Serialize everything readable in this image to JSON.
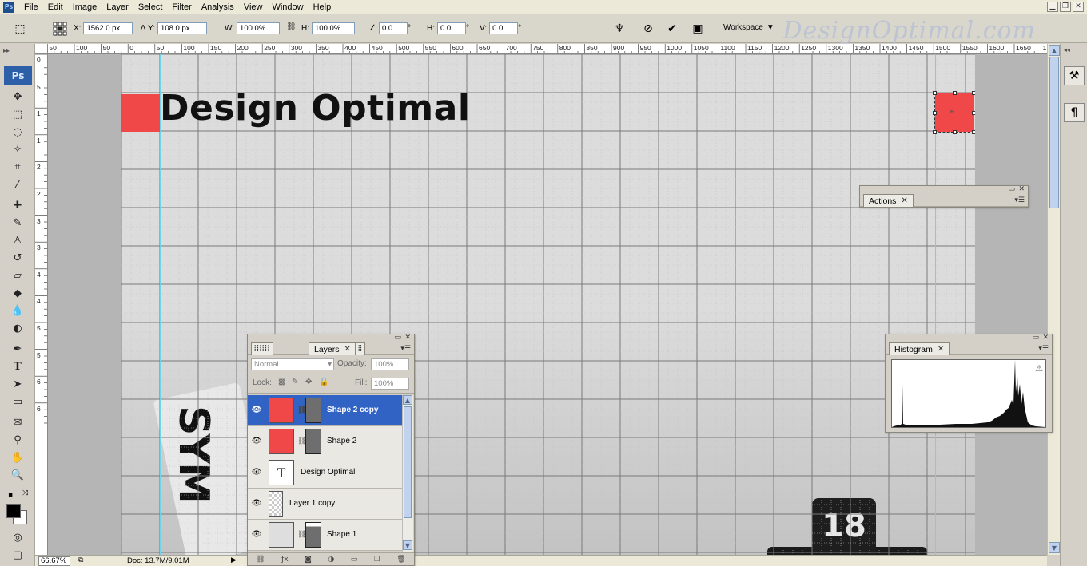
{
  "menu": [
    "File",
    "Edit",
    "Image",
    "Layer",
    "Select",
    "Filter",
    "Analysis",
    "View",
    "Window",
    "Help"
  ],
  "app_icon": "Ps",
  "window_controls": [
    "minimize",
    "restore",
    "close"
  ],
  "options": {
    "x_label": "X:",
    "x_value": "1562.0 px",
    "y_label": "Y:",
    "y_value": "108.0 px",
    "w_label": "W:",
    "w_value": "100.0%",
    "h_label": "H:",
    "h_value": "100.0%",
    "angle_value": "0.0",
    "angle_unit": "°",
    "hskew_label": "H:",
    "hskew_value": "0.0",
    "hskew_unit": "°",
    "vskew_label": "V:",
    "vskew_value": "0.0",
    "vskew_unit": "°",
    "workspace_label": "Workspace"
  },
  "watermark": "DesignOptimal.com",
  "tools_badge": "Ps",
  "ruler_top_labels": [
    "50",
    "100",
    "50",
    "0",
    "50",
    "100",
    "150",
    "200",
    "250",
    "300",
    "350",
    "400",
    "450",
    "500",
    "550",
    "600",
    "650",
    "700",
    "750",
    "800",
    "850",
    "900",
    "950",
    "1000",
    "1050",
    "1100",
    "1150",
    "1200",
    "1250",
    "1300",
    "1350",
    "1400",
    "1450",
    "1500",
    "1550",
    "1600",
    "1650",
    "1700"
  ],
  "ruler_left_labels": [
    "0",
    "5",
    "1",
    "1",
    "2",
    "2",
    "3",
    "3",
    "4",
    "4",
    "5",
    "5",
    "6",
    "6"
  ],
  "canvas": {
    "title_text": "Design Optimal",
    "photo_text": "SYM",
    "clock_number": "18"
  },
  "status": {
    "zoom": "66.67%",
    "doc": "Doc: 13.7M/9.01M"
  },
  "layers_panel": {
    "tab_label": "Layers",
    "blend_mode": "Normal",
    "opacity_label": "Opacity:",
    "opacity_value": "100%",
    "lock_label": "Lock:",
    "fill_label": "Fill:",
    "fill_value": "100%",
    "layers": [
      {
        "name": "Shape 2 copy",
        "selected": true
      },
      {
        "name": "Shape 2",
        "selected": false
      },
      {
        "name": "Design Optimal",
        "selected": false
      },
      {
        "name": "Layer 1 copy",
        "selected": false
      },
      {
        "name": "Shape 1",
        "selected": false
      }
    ]
  },
  "actions_panel": {
    "tab_label": "Actions"
  },
  "histogram_panel": {
    "tab_label": "Histogram",
    "warning": "⚠"
  },
  "colors": {
    "accent_red": "#f04848",
    "selection_blue": "#3163c5",
    "guide_cyan": "#6fd4e8"
  }
}
